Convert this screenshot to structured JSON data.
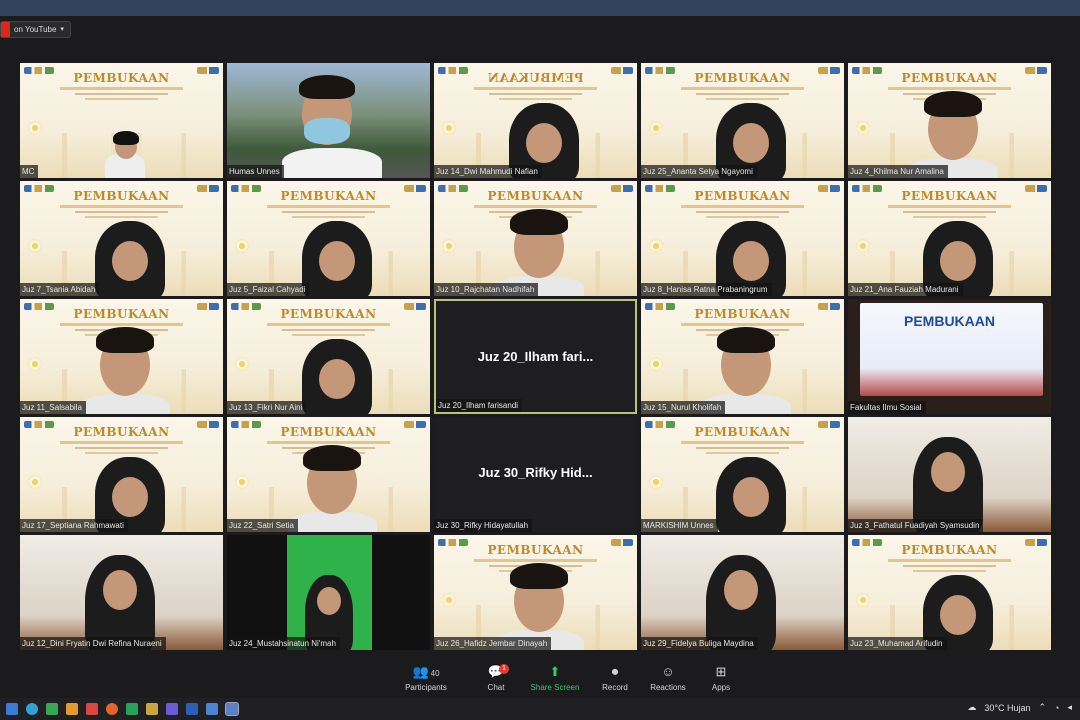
{
  "stream": {
    "badge": "on YouTube",
    "caret": "▾"
  },
  "banner_title": "PEMBUKAAN",
  "tiles": [
    {
      "label": "MC",
      "type": "banner"
    },
    {
      "label": "Humas Unnes",
      "type": "camera"
    },
    {
      "label": "Juz 14_Dwi Mahmudi Nafian",
      "type": "banner-mirror"
    },
    {
      "label": "Juz 25_Ananta Setya Ngayomi",
      "type": "banner"
    },
    {
      "label": "Juz 4_Khilma Nur Amalina",
      "type": "banner"
    },
    {
      "label": "Juz 7_Tsania Abidah",
      "type": "banner"
    },
    {
      "label": "Juz 5_Faizal Cahyadi",
      "type": "banner"
    },
    {
      "label": "Juz 10_Rajchatan Nadhifah",
      "type": "banner"
    },
    {
      "label": "Juz 8_Hanisa Ratna Prabaningrum",
      "type": "banner"
    },
    {
      "label": "Juz 21_Ana Fauziah Madurani",
      "type": "banner"
    },
    {
      "label": "Juz 11_Salsabila",
      "type": "banner"
    },
    {
      "label": "Juz 13_Fikri Nur Aini",
      "type": "banner"
    },
    {
      "label": "Juz 20_Ilham farisandi",
      "type": "name",
      "display": "Juz 20_Ilham fari..."
    },
    {
      "label": "Juz 15_Nurul Kholifah",
      "type": "banner"
    },
    {
      "label": "Fakultas Ilmu Sosial",
      "type": "screen"
    },
    {
      "label": "Juz 17_Septiana Rahmawati",
      "type": "banner"
    },
    {
      "label": "Juz 22_Satri Setia",
      "type": "banner"
    },
    {
      "label": "Juz 30_Rifky Hidayatullah",
      "type": "name",
      "display": "Juz 30_Rifky Hid..."
    },
    {
      "label": "MARKISHIM Unnes",
      "type": "banner"
    },
    {
      "label": "Juz 3_Fathatul Fuadiyah Syamsudin",
      "type": "camera-room"
    },
    {
      "label": "Juz 12_Dini Fryatin Dwi Refina Nuraeni",
      "type": "camera-room"
    },
    {
      "label": "Juz 24_Mustahsinatun Ni'mah",
      "type": "green"
    },
    {
      "label": "Juz 26_Hafidz Jembar Dinayah",
      "type": "banner"
    },
    {
      "label": "Juz 29_Fidelya Buliga Maydina",
      "type": "camera-room"
    },
    {
      "label": "Juz 23_Muhamad Arifudin",
      "type": "banner"
    }
  ],
  "toolbar": {
    "participants_label": "Participants",
    "participants_count": "40",
    "chat_label": "Chat",
    "chat_badge": "1",
    "share_label": "Share Screen",
    "record_label": "Record",
    "reactions_label": "Reactions",
    "apps_label": "Apps"
  },
  "taskbar": {
    "weather": "30°C Hujan"
  },
  "colors": {
    "accent_green": "#3bc76b",
    "banner_gold": "#c08a2a",
    "active_border": "#b7c27a"
  }
}
